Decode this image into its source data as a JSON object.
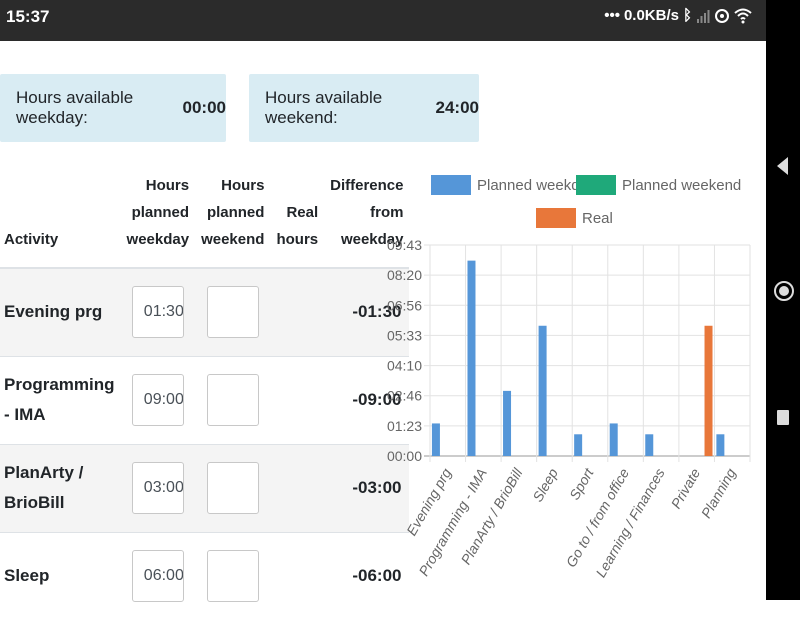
{
  "status_bar": {
    "time": "15:37",
    "network_speed": "0.0KB/s",
    "icons": [
      "dots-icon",
      "bluetooth-icon",
      "signal-icon",
      "sync-icon",
      "wifi-icon"
    ]
  },
  "info_boxes": [
    {
      "label": "Hours available weekday:",
      "value": "00:00"
    },
    {
      "label": "Hours available weekend:",
      "value": "24:00"
    }
  ],
  "table": {
    "headers": {
      "activity": "Activity",
      "planned_weekday": [
        "Hours",
        "planned",
        "weekday"
      ],
      "planned_weekend": [
        "Hours",
        "planned",
        "weekend"
      ],
      "real": [
        "Real",
        "hours"
      ],
      "difference": [
        "Difference",
        "from",
        "weekday"
      ]
    },
    "rows": [
      {
        "name": [
          "Evening prg"
        ],
        "weekday_value": "01:30",
        "weekend_value": "",
        "diff": "-01:30"
      },
      {
        "name": [
          "Programming",
          "- IMA"
        ],
        "weekday_value": "09:00",
        "weekend_value": "",
        "diff": "-09:00"
      },
      {
        "name": [
          "PlanArty /",
          "BrioBill"
        ],
        "weekday_value": "03:00",
        "weekend_value": "",
        "diff": "-03:00"
      },
      {
        "name": [
          "Sleep"
        ],
        "weekday_value": "06:00",
        "weekend_value": "",
        "diff": "-06:00"
      }
    ]
  },
  "colors": {
    "planned_weekday": "#5596d8",
    "planned_weekend": "#1fa97a",
    "real": "#e8773a",
    "info_box_bg": "#d9ecf3"
  },
  "chart_data": {
    "type": "bar",
    "legend": [
      "Planned weekday",
      "Planned weekend",
      "Real"
    ],
    "legend_placement": "top",
    "categories": [
      "Evening prg",
      "Programming - IMA",
      "PlanArty / BrioBill",
      "Sleep",
      "Sport",
      "Go to / from office",
      "Learning / Finances",
      "Private",
      "Planning"
    ],
    "series": [
      {
        "name": "Planned weekday",
        "values": [
          1.5,
          9.0,
          3.0,
          6.0,
          1.0,
          1.5,
          1.0,
          0,
          1.0
        ]
      },
      {
        "name": "Planned weekend",
        "values": [
          0,
          0,
          0,
          0,
          0,
          0,
          0,
          0,
          0
        ]
      },
      {
        "name": "Real",
        "values": [
          0,
          0,
          0,
          0,
          0,
          0,
          0,
          6.0,
          0
        ]
      }
    ],
    "y_ticks": [
      "00:00",
      "01:23",
      "02:46",
      "04:10",
      "05:33",
      "06:56",
      "08:20",
      "09:43"
    ],
    "ylim": [
      0,
      9.72
    ],
    "grid": true
  }
}
